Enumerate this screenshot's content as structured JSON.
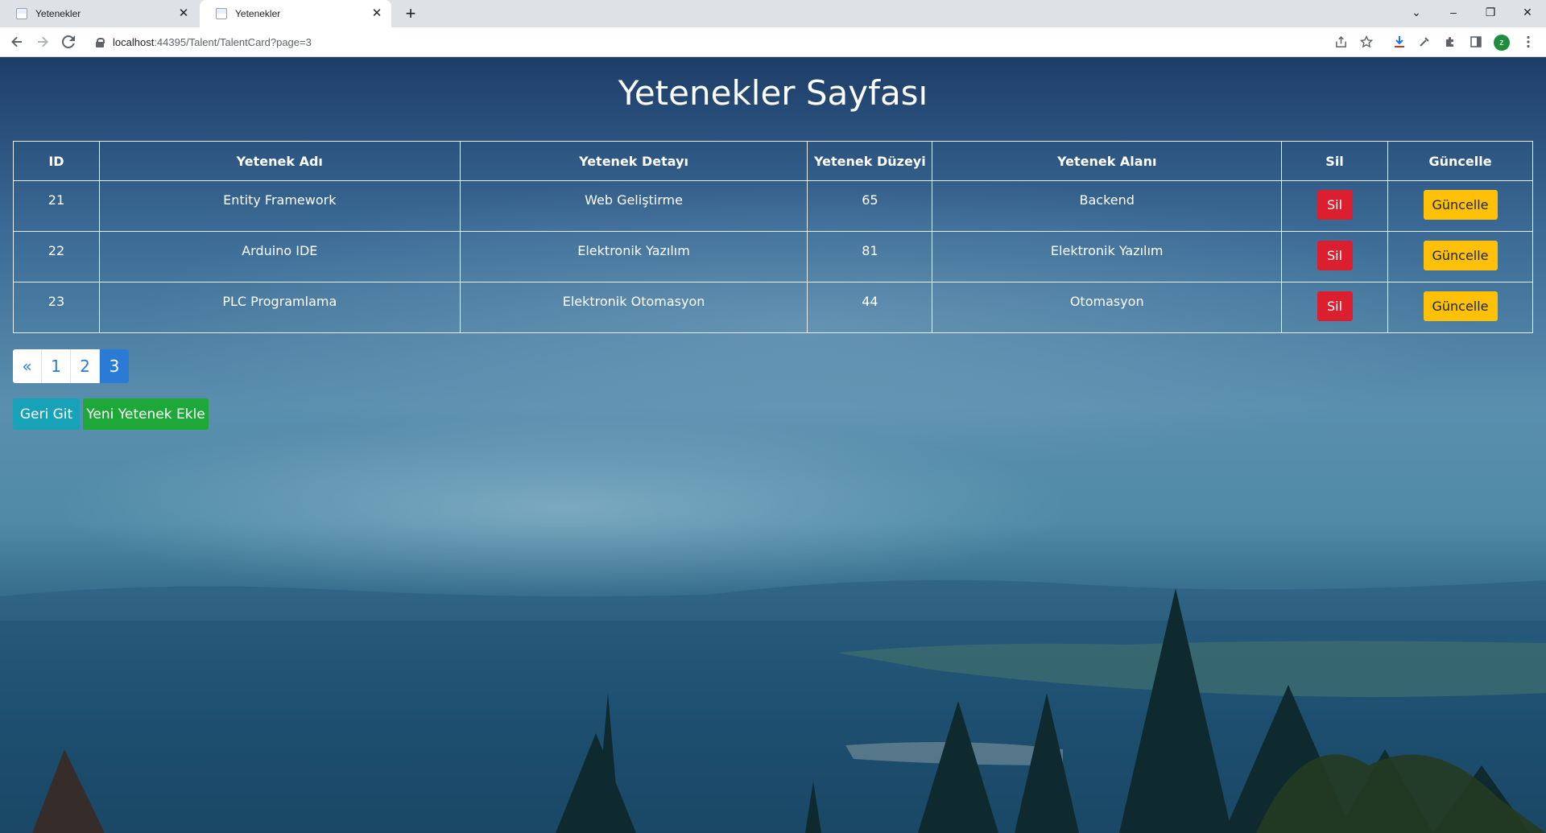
{
  "browser": {
    "tabs": [
      {
        "title": "Yetenekler",
        "close": "✕"
      },
      {
        "title": "Yetenekler",
        "close": "✕"
      }
    ],
    "new_tab": "+",
    "url_host": "localhost",
    "url_path": ":44395/Talent/TalentCard?page=3",
    "avatar_letter": "z",
    "window_controls": {
      "chevron": "⌄",
      "minimize": "–",
      "restore": "❐",
      "close": "✕"
    }
  },
  "page": {
    "title": "Yetenekler Sayfası",
    "table": {
      "headers": [
        "ID",
        "Yetenek Adı",
        "Yetenek Detayı",
        "Yetenek Düzeyi",
        "Yetenek Alanı",
        "Sil",
        "Güncelle"
      ],
      "rows": [
        {
          "id": "21",
          "name": "Entity Framework",
          "detail": "Web Geliştirme",
          "level": "65",
          "area": "Backend",
          "delete": "Sil",
          "update": "Güncelle"
        },
        {
          "id": "22",
          "name": "Arduino IDE",
          "detail": "Elektronik Yazılım",
          "level": "81",
          "area": "Elektronik Yazılım",
          "delete": "Sil",
          "update": "Güncelle"
        },
        {
          "id": "23",
          "name": "PLC Programlama",
          "detail": "Elektronik Otomasyon",
          "level": "44",
          "area": "Otomasyon",
          "delete": "Sil",
          "update": "Güncelle"
        }
      ]
    },
    "pagination": {
      "prev": "«",
      "pages": [
        "1",
        "2",
        "3"
      ],
      "current": "3"
    },
    "back_button": "Geri Git",
    "add_button": "Yeni Yetenek Ekle"
  },
  "colors": {
    "delete": "#dc1f2f",
    "update": "#ffc107",
    "back": "#17a2b8",
    "add": "#1ea83a",
    "pagination_active": "#2a7bd6"
  }
}
